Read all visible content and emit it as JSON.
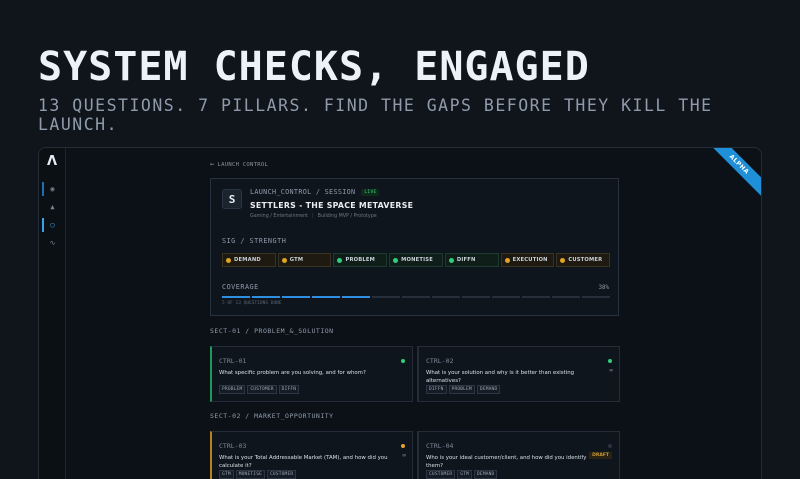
{
  "hero": {
    "title": "SYSTEM CHECKS, ENGAGED",
    "subtitle": "13 QUESTIONS. 7 PILLARS. FIND THE GAPS BEFORE THEY KILL THE LAUNCH."
  },
  "app": {
    "logo": "Λ",
    "ribbon": "ALPHA",
    "back_label": "LAUNCH CONTROL"
  },
  "session": {
    "crumb": "LAUNCH_CONTROL / SESSION",
    "live_badge": "LIVE",
    "title": "SETTLERS - THE SPACE METAVERSE",
    "category": "Gaming / Entertainment",
    "stage": "Building MVP / Prototype",
    "signal_label": "SIG / STRENGTH",
    "pillars": [
      {
        "label": "DEMAND",
        "status": "warn"
      },
      {
        "label": "GTM",
        "status": "warn"
      },
      {
        "label": "PROBLEM",
        "status": "ok"
      },
      {
        "label": "MONETISE",
        "status": "ok"
      },
      {
        "label": "DIFFN",
        "status": "ok"
      },
      {
        "label": "EXECUTION",
        "status": "warn"
      },
      {
        "label": "CUSTOMER",
        "status": "warn"
      }
    ],
    "coverage_label": "COVERAGE",
    "coverage_pct": "38%",
    "coverage_segments_filled": 5,
    "coverage_segments_total": 13,
    "questions_done": "5 OF 13 QUESTIONS DONE"
  },
  "colors": {
    "ok": "#2fce7b",
    "warn": "#e0a526",
    "accent": "#2e8fe0"
  },
  "sections": [
    {
      "label": "SECT-01 / PROBLEM_&_SOLUTION"
    },
    {
      "label": "SECT-02 / MARKET_OPPORTUNITY"
    }
  ],
  "questions": [
    {
      "id": "CTRL-01",
      "text": "What specific problem are you solving, and for whom?",
      "tags": [
        "PROBLEM",
        "CUSTOMER",
        "DIFFN"
      ]
    },
    {
      "id": "CTRL-02",
      "text": "What is your solution and why is it better than existing alternatives?",
      "tags": [
        "DIFFN",
        "PROBLEM",
        "DEMAND"
      ]
    },
    {
      "id": "CTRL-03",
      "text": "What is your Total Addressable Market (TAM), and how did you calculate it?",
      "tags": [
        "GTM",
        "MONETISE",
        "CUSTOMER"
      ]
    },
    {
      "id": "CTRL-04",
      "text": "Who is your ideal customer/client, and how did you identify them?",
      "tags": [
        "CUSTOMER",
        "GTM",
        "DEMAND"
      ],
      "badge": "DRAFT"
    }
  ]
}
